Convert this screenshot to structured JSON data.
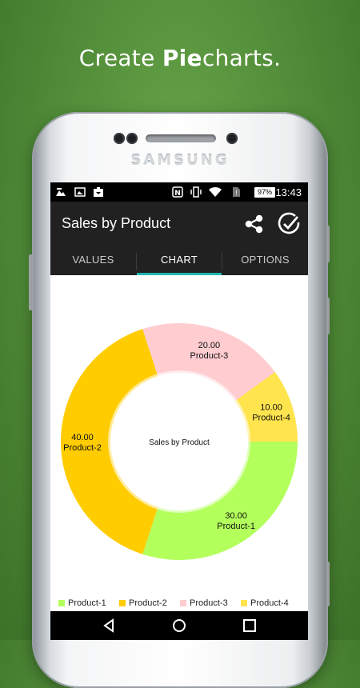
{
  "promo": {
    "prefix": "Create ",
    "bold": "Pie",
    "suffix": "charts."
  },
  "device": {
    "brand": "SAMSUNG"
  },
  "status_bar": {
    "time": "13:43",
    "battery": "97%"
  },
  "app_bar": {
    "title": "Sales by Product",
    "share_icon": "share-icon",
    "done_icon": "done-circle-icon"
  },
  "tabs": [
    {
      "label": "VALUES",
      "active": false
    },
    {
      "label": "CHART",
      "active": true
    },
    {
      "label": "OPTIONS",
      "active": false
    }
  ],
  "chart_data": {
    "type": "pie",
    "title": "Sales by Product",
    "donut": true,
    "legend_position": "bottom",
    "slices": [
      {
        "label": "Product-1",
        "value": 30.0,
        "display": "30.00",
        "color": "#b3ff5c"
      },
      {
        "label": "Product-2",
        "value": 40.0,
        "display": "40.00",
        "color": "#ffcc00"
      },
      {
        "label": "Product-3",
        "value": 20.0,
        "display": "20.00",
        "color": "#ffccd0"
      },
      {
        "label": "Product-4",
        "value": 10.0,
        "display": "10.00",
        "color": "#ffe44d"
      }
    ]
  },
  "colors": {
    "appbar": "#212121",
    "tab_indicator": "#1fb5b0",
    "background": "#5a963f"
  }
}
